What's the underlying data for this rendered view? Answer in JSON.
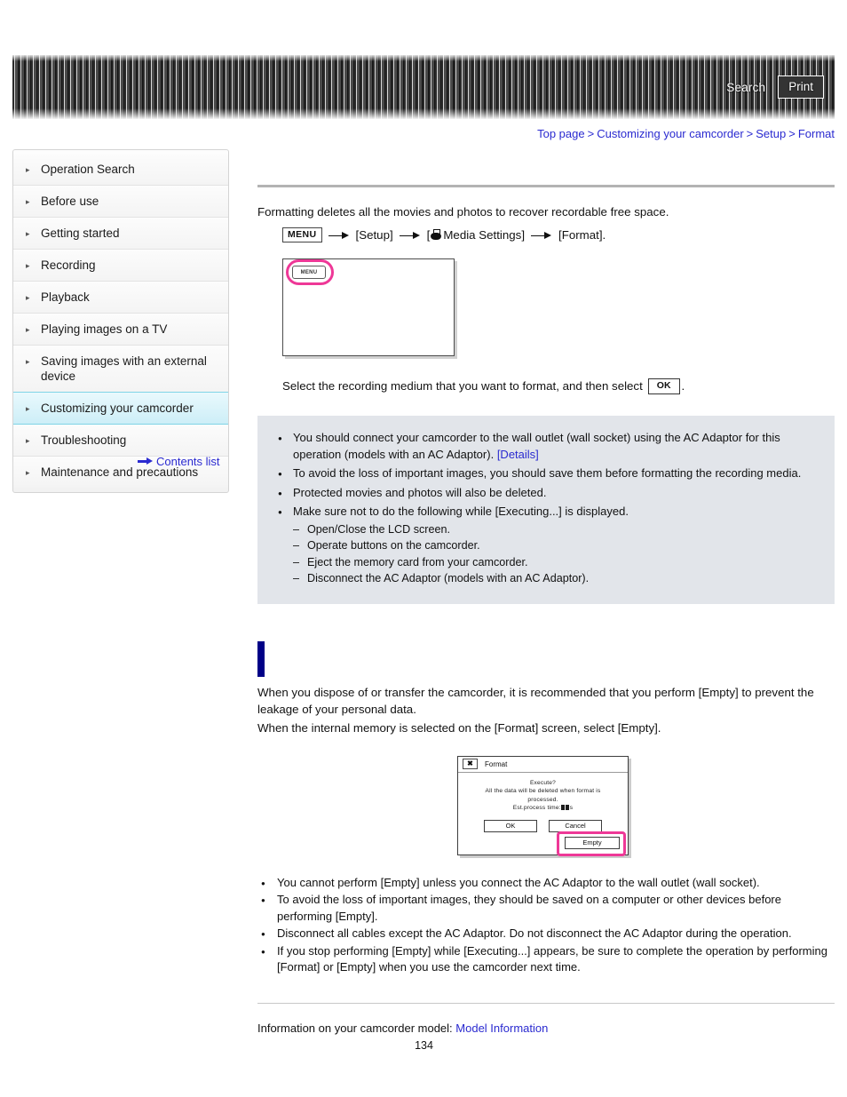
{
  "header": {
    "search_label": "Search",
    "print_label": "Print"
  },
  "breadcrumb": {
    "items": [
      "Top page",
      "Customizing your camcorder",
      "Setup",
      "Format"
    ],
    "separator": ">"
  },
  "sidebar": {
    "items": [
      {
        "label": "Operation Search",
        "active": false
      },
      {
        "label": "Before use",
        "active": false
      },
      {
        "label": "Getting started",
        "active": false
      },
      {
        "label": "Recording",
        "active": false
      },
      {
        "label": "Playback",
        "active": false
      },
      {
        "label": "Playing images on a TV",
        "active": false
      },
      {
        "label": "Saving images with an external device",
        "active": false
      },
      {
        "label": "Customizing your camcorder",
        "active": true
      },
      {
        "label": "Troubleshooting",
        "active": false
      },
      {
        "label": "Maintenance and precautions",
        "active": false
      }
    ],
    "contents_list_label": "Contents list"
  },
  "main": {
    "page_title": "",
    "intro": "Formatting deletes all the movies and photos to recover recordable free space.",
    "menu_path": {
      "menu_chip": "MENU",
      "step1": "[Setup]",
      "step2_prefix": "[",
      "step2": "Media Settings]",
      "step3": "[Format]."
    },
    "lcd_shot": {
      "menu_button_label": "MENU"
    },
    "after_shot_text": "Select the recording medium that you want to format, and then select",
    "ok_chip": "OK",
    "after_shot_period": ".",
    "notes": [
      {
        "text": "You should connect your camcorder to the wall outlet (wall socket) using the AC Adaptor for this operation (models with an AC Adaptor).",
        "link": "[Details]"
      },
      {
        "text": "To avoid the loss of important images, you should save them before formatting the recording media."
      },
      {
        "text": "Protected movies and photos will also be deleted."
      },
      {
        "text": "Make sure not to do the following while [Executing...] is displayed.",
        "subitems": [
          "Open/Close the LCD screen.",
          "Operate buttons on the camcorder.",
          "Eject the memory card from your camcorder.",
          "Disconnect the AC Adaptor (models with an AC Adaptor)."
        ]
      }
    ],
    "section": {
      "heading": "",
      "paragraph1": "When you dispose of or transfer the camcorder, it is recommended that you perform [Empty] to prevent the leakage of your personal data.",
      "paragraph2": "When the internal memory is selected on the [Format] screen, select [Empty]."
    },
    "dialog": {
      "close_glyph": "✖",
      "title": "Format",
      "line1": "Execute?",
      "line2": "All the data will be deleted when format is",
      "line3": "processed.",
      "line4_prefix": "Est.process time:",
      "line4_suffix": "s",
      "ok_label": "OK",
      "cancel_label": "Cancel",
      "empty_label": "Empty"
    },
    "bottom_notes": [
      "You cannot perform [Empty] unless you connect the AC Adaptor to the wall outlet (wall socket).",
      "To avoid the loss of important images, they should be saved on a computer or other devices before performing [Empty].",
      "Disconnect all cables except the AC Adaptor. Do not disconnect the AC Adaptor during the operation.",
      "If you stop performing [Empty] while [Executing...] appears, be sure to complete the operation by performing [Format] or [Empty] when you use the camcorder next time."
    ]
  },
  "footer": {
    "model_text": "Information on your camcorder model:",
    "model_link": "Model Information",
    "page_number": "134"
  },
  "colors": {
    "link": "#2a2ad0",
    "active_nav_border": "#7fd4e6",
    "highlight_ring": "#ee3897",
    "section_bar": "#000087",
    "note_box_bg": "#e2e5ea"
  }
}
